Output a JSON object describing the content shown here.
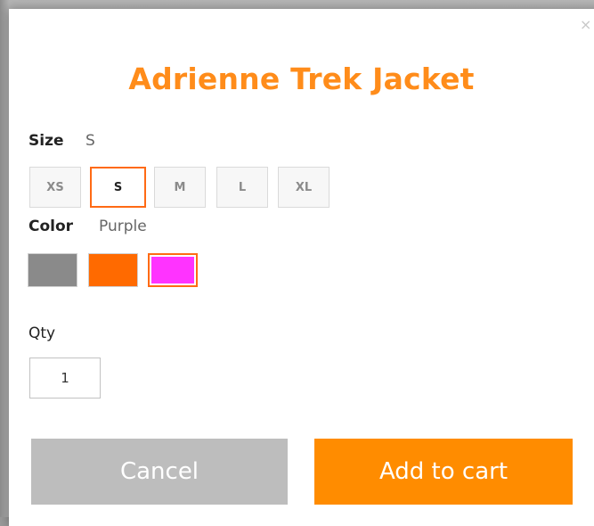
{
  "modal": {
    "close_glyph": "×",
    "title": "Adrienne Trek Jacket"
  },
  "size": {
    "label": "Size",
    "selected": "S",
    "options": [
      "XS",
      "S",
      "M",
      "L",
      "XL"
    ]
  },
  "color": {
    "label": "Color",
    "selected": "Purple",
    "swatches": [
      {
        "name": "gray",
        "hex": "#8a8a8a"
      },
      {
        "name": "orange",
        "hex": "#ff6a00"
      },
      {
        "name": "purple",
        "hex": "#ff33ff"
      }
    ]
  },
  "qty": {
    "label": "Qty",
    "value": "1"
  },
  "actions": {
    "cancel_label": "Cancel",
    "add_label": "Add to cart"
  },
  "colors": {
    "accent": "#ff8c00",
    "selected_border": "#ff6a14",
    "cancel_bg": "#bdbdbd"
  }
}
